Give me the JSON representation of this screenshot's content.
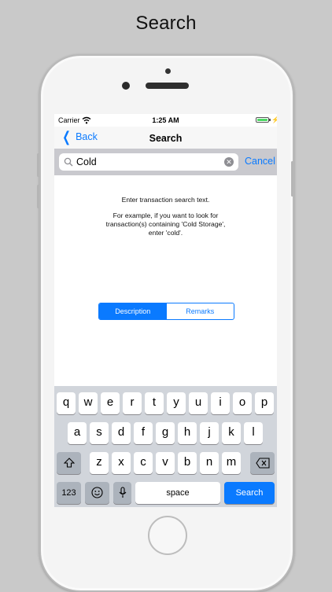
{
  "header": {
    "title": "Search"
  },
  "status_bar": {
    "carrier": "Carrier",
    "time": "1:25 AM"
  },
  "nav": {
    "back_label": "Back",
    "title": "Search"
  },
  "search": {
    "value": "Cold",
    "cancel_label": "Cancel"
  },
  "help": {
    "line1": "Enter transaction search text.",
    "line2": "For example, if you want to look for",
    "line3": "transaction(s) containing 'Cold Storage',",
    "line4": "enter 'cold'."
  },
  "segments": [
    {
      "label": "Description",
      "selected": true
    },
    {
      "label": "Remarks",
      "selected": false
    }
  ],
  "keyboard": {
    "row1": [
      "q",
      "w",
      "e",
      "r",
      "t",
      "y",
      "u",
      "i",
      "o",
      "p"
    ],
    "row2": [
      "a",
      "s",
      "d",
      "f",
      "g",
      "h",
      "j",
      "k",
      "l"
    ],
    "row3": [
      "z",
      "x",
      "c",
      "v",
      "b",
      "n",
      "m"
    ],
    "numbers_label": "123",
    "space_label": "space",
    "search_label": "Search",
    "shift_icon": "shift-icon",
    "delete_icon": "delete-icon",
    "emoji_icon": "emoji-icon",
    "mic_icon": "microphone-icon"
  },
  "colors": {
    "accent": "#0a7aff",
    "battery": "#4cd964",
    "background": "#c9c9c9"
  }
}
